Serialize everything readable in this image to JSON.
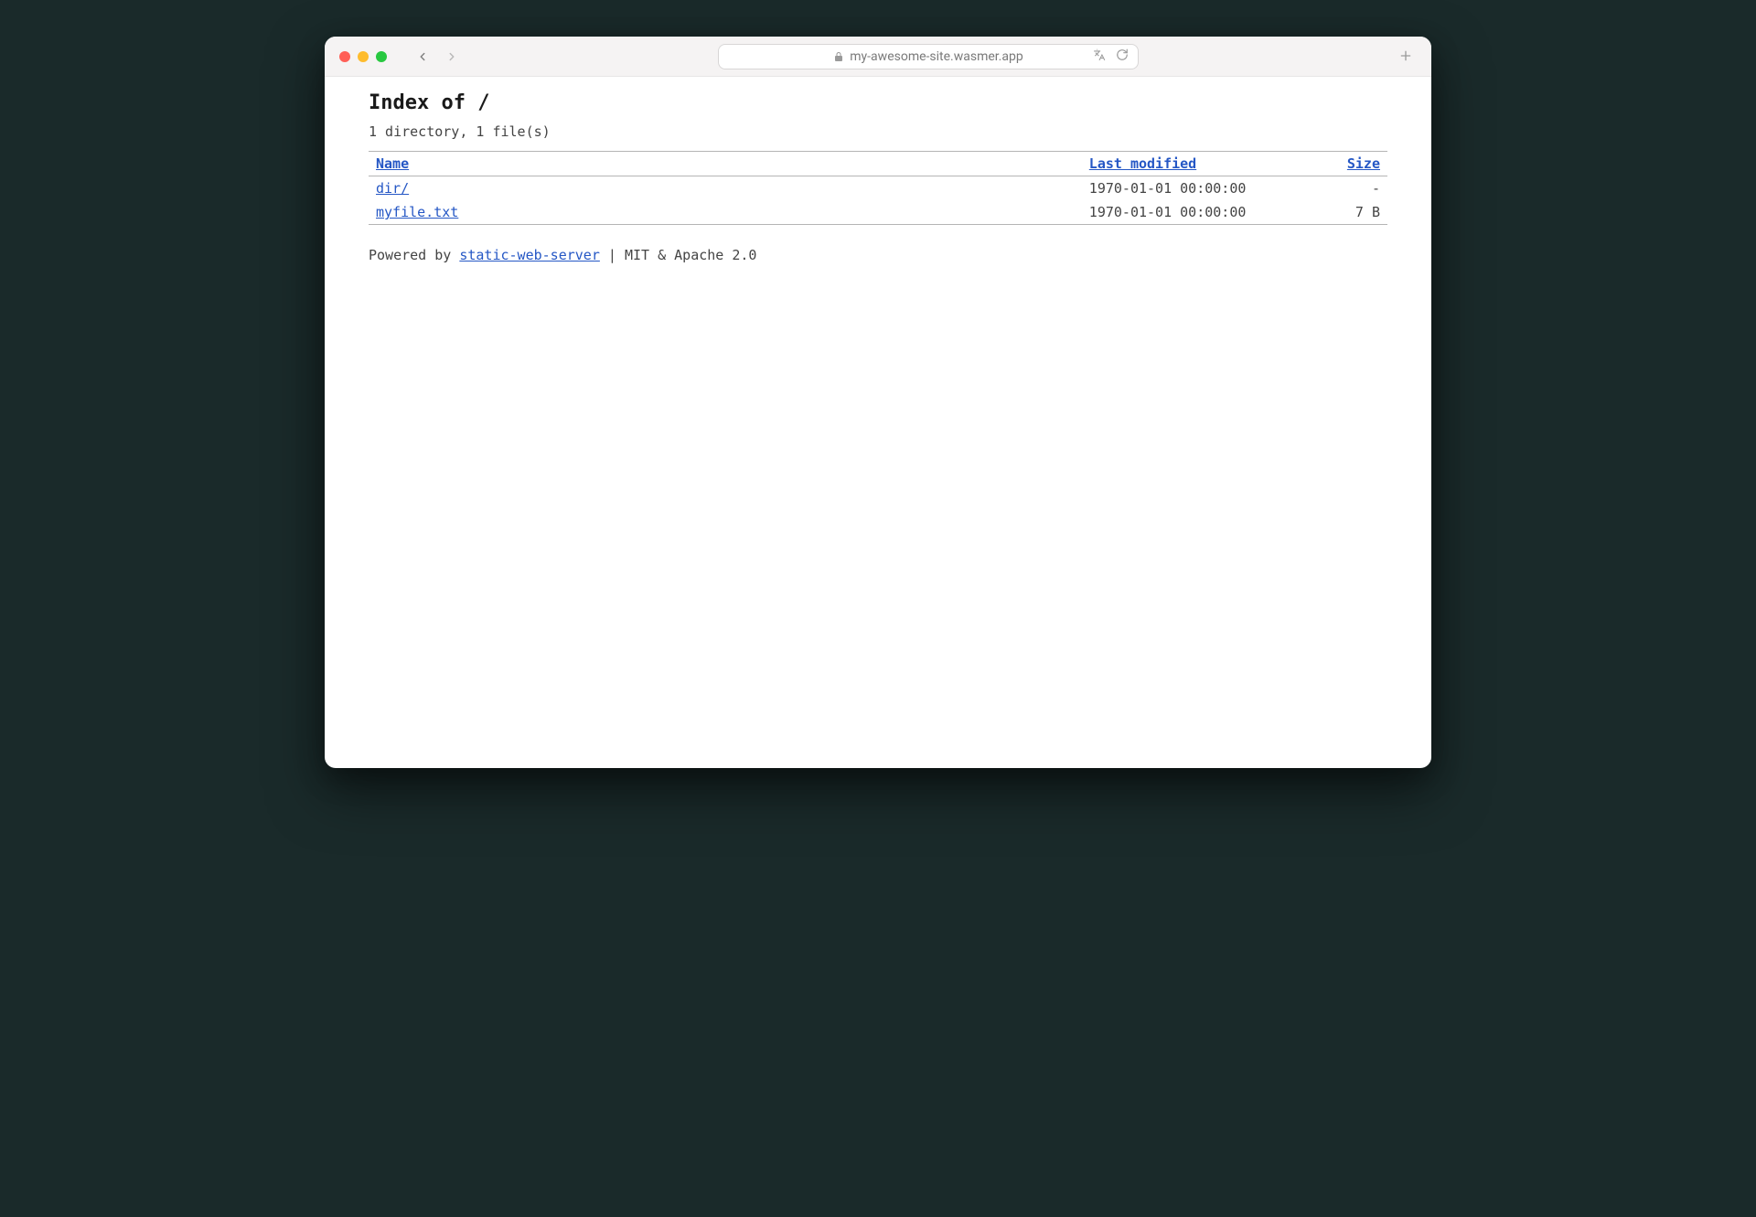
{
  "browser": {
    "url": "my-awesome-site.wasmer.app"
  },
  "page": {
    "title": "Index of /",
    "summary": "1 directory, 1 file(s)"
  },
  "columns": {
    "name": "Name",
    "modified": "Last modified",
    "size": "Size"
  },
  "entries": [
    {
      "name": "dir/",
      "modified": "1970-01-01 00:00:00",
      "size": "-"
    },
    {
      "name": "myfile.txt",
      "modified": "1970-01-01 00:00:00",
      "size": "7 B"
    }
  ],
  "footer": {
    "prefix": "Powered by ",
    "link_text": "static-web-server",
    "suffix": " | MIT & Apache 2.0"
  }
}
